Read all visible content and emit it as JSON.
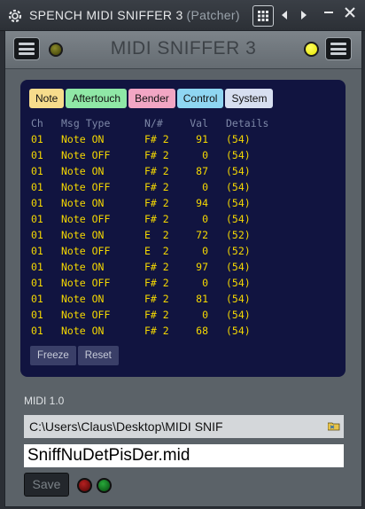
{
  "window": {
    "title": "SPENCH MIDI SNIFFER 3",
    "subtitle": "(Patcher)",
    "icons": [
      "gear-icon",
      "grid-icon",
      "arrow-left-icon",
      "arrow-right-icon",
      "minimize-icon",
      "close-icon"
    ]
  },
  "header": {
    "title": "MIDI SNIFFER 3",
    "left_led_color": "#6b6b12",
    "right_led_color": "#ffff33"
  },
  "filters": [
    {
      "label": "Note",
      "color": "#f7dc8c"
    },
    {
      "label": "Aftertouch",
      "color": "#8fe8a6"
    },
    {
      "label": "Bender",
      "color": "#f2a6c4"
    },
    {
      "label": "Control",
      "color": "#8fd6f2"
    },
    {
      "label": "System",
      "color": "#d7dff0"
    }
  ],
  "log": {
    "columns": {
      "ch": "Ch",
      "type": "Msg Type",
      "note": "N/#",
      "val": "Val",
      "details": "Details"
    },
    "rows": [
      {
        "ch": "01",
        "type": "Note ON",
        "note": "F# 2",
        "val": "91",
        "details": "(54)"
      },
      {
        "ch": "01",
        "type": "Note OFF",
        "note": "F# 2",
        "val": "0",
        "details": "(54)"
      },
      {
        "ch": "01",
        "type": "Note ON",
        "note": "F# 2",
        "val": "87",
        "details": "(54)"
      },
      {
        "ch": "01",
        "type": "Note OFF",
        "note": "F# 2",
        "val": "0",
        "details": "(54)"
      },
      {
        "ch": "01",
        "type": "Note ON",
        "note": "F# 2",
        "val": "94",
        "details": "(54)"
      },
      {
        "ch": "01",
        "type": "Note OFF",
        "note": "F# 2",
        "val": "0",
        "details": "(54)"
      },
      {
        "ch": "01",
        "type": "Note ON",
        "note": "E  2",
        "val": "72",
        "details": "(52)"
      },
      {
        "ch": "01",
        "type": "Note OFF",
        "note": "E  2",
        "val": "0",
        "details": "(52)"
      },
      {
        "ch": "01",
        "type": "Note ON",
        "note": "F# 2",
        "val": "97",
        "details": "(54)"
      },
      {
        "ch": "01",
        "type": "Note OFF",
        "note": "F# 2",
        "val": "0",
        "details": "(54)"
      },
      {
        "ch": "01",
        "type": "Note ON",
        "note": "F# 2",
        "val": "81",
        "details": "(54)"
      },
      {
        "ch": "01",
        "type": "Note OFF",
        "note": "F# 2",
        "val": "0",
        "details": "(54)"
      },
      {
        "ch": "01",
        "type": "Note ON",
        "note": "F# 2",
        "val": "68",
        "details": "(54)"
      }
    ]
  },
  "actions": {
    "freeze_label": "Freeze",
    "reset_label": "Reset"
  },
  "midi_version": "MIDI 1.0",
  "file": {
    "path": "C:\\Users\\Claus\\Desktop\\MIDI SNIF",
    "name": "SniffNuDetPisDer.mid",
    "save_label": "Save",
    "status_leds": [
      {
        "name": "red",
        "color": "#8a1010"
      },
      {
        "name": "green",
        "color": "#1a8a2a"
      }
    ]
  }
}
